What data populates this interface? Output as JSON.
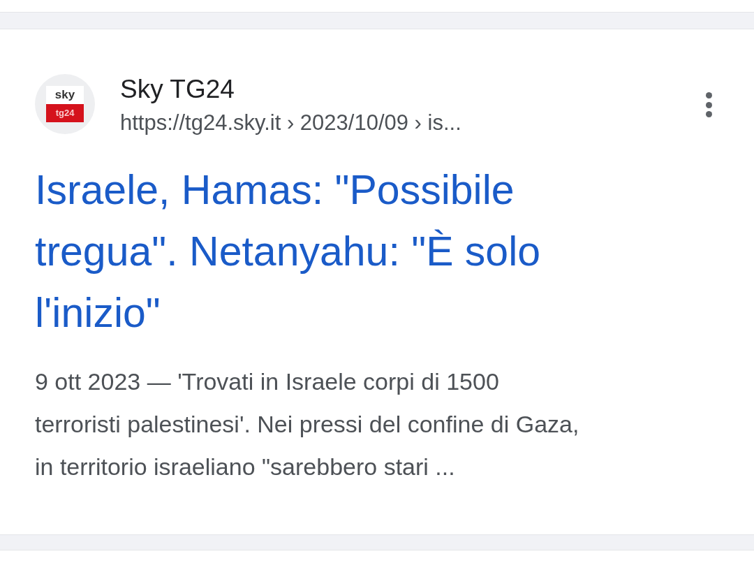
{
  "result": {
    "logo": {
      "top": "sky",
      "bottom": "tg24"
    },
    "site_name": "Sky TG24",
    "url": "https://tg24.sky.it › 2023/10/09 › is...",
    "title": "Israele, Hamas: \"Possibile tregua\". Netanyahu: \"È solo l'inizio\"",
    "snippet_lines": [
      "9 ott 2023 — 'Trovati in Israele corpi di 1500",
      "terroristi palestinesi'. Nei pressi del confine di Gaza,",
      "in territorio israeliano \"sarebbero stari ..."
    ]
  }
}
